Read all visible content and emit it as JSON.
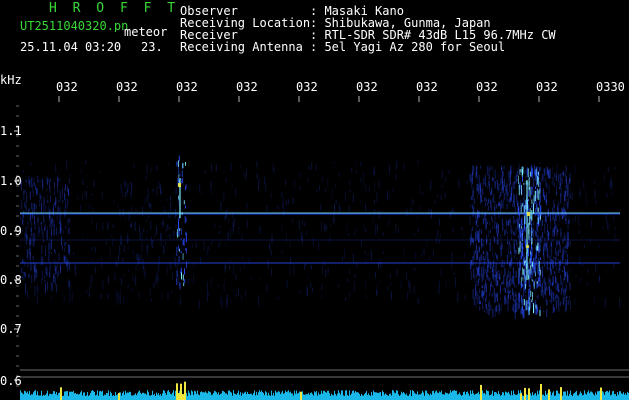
{
  "header": {
    "brand": "H R O F F T",
    "file_name": "UT2511040320.pn",
    "event_type": "meteor",
    "datetime": "25.11.04 03:20",
    "number": "23.",
    "observer_label": "Observer",
    "observer_value": ": Masaki Kano",
    "location_label": "Receiving Location",
    "location_value": ": Shibukawa, Gunma, Japan",
    "receiver_label": "Receiver",
    "receiver_value": ": RTL-SDR SDR# 43dB L15 96.7MHz CW",
    "antenna_label": "Receiving Antenna",
    "antenna_value": ": 5el Yagi Az 280 for Seoul"
  },
  "spectrogram": {
    "y_unit": "kHz",
    "time_ticks": [
      "032",
      "032",
      "032",
      "032",
      "032",
      "032",
      "032",
      "032",
      "032",
      "0330"
    ],
    "freq_ticks": [
      "1.1",
      "1.0",
      "0.9",
      "0.8",
      "0.7",
      "0.6"
    ],
    "colors": {
      "background": "#000000",
      "signal": "#2a4cff",
      "bright": "#7df0ff",
      "hot": "#f0e640",
      "baseline": "#19b8e8",
      "grid": "#8a8a8a"
    }
  }
}
